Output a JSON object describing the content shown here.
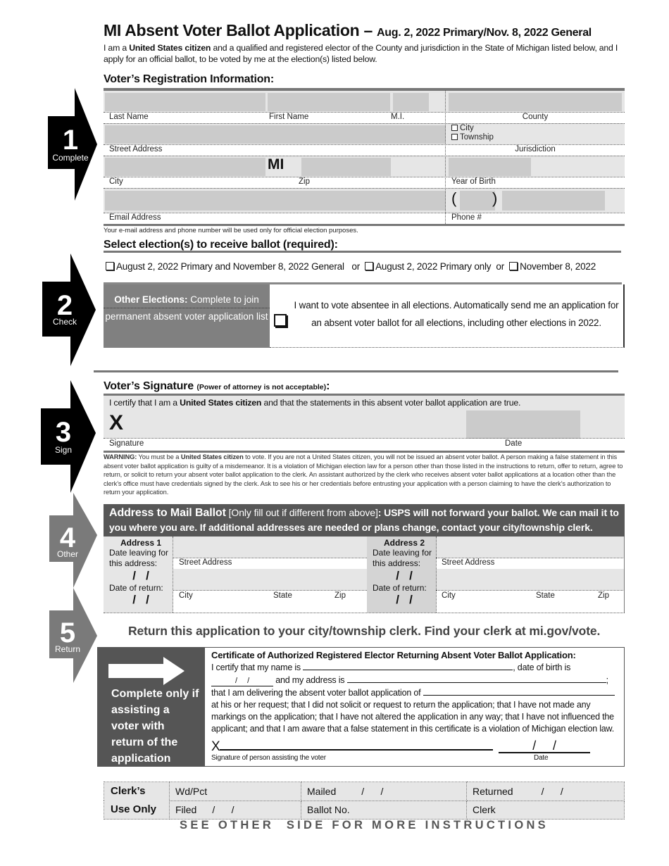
{
  "header": {
    "title": "MI Absent Voter Ballot Application –",
    "subtitle": "Aug. 2, 2022 Primary/Nov. 8, 2022 General",
    "intro_pre": "I am a ",
    "intro_bold": "United States citizen",
    "intro_post": " and a qualified and registered elector of the County and jurisdiction in the State of Michigan listed below, and I apply for an official ballot, to be voted by me at the election(s) listed below."
  },
  "steps": [
    {
      "number": "1",
      "word": "Complete"
    },
    {
      "number": "2",
      "word": "Check"
    },
    {
      "number": "3",
      "word": "Sign"
    },
    {
      "number": "4",
      "word": "Other"
    },
    {
      "number": "5",
      "word": "Return"
    }
  ],
  "registration": {
    "heading": "Voter’s Registration Information:",
    "last_name": "Last Name",
    "first_name": "First Name",
    "mi": "M.I.",
    "county": "County",
    "street": "Street Address",
    "city_option": "City",
    "township_option": "Township",
    "jurisdiction": "Jurisdiction",
    "state_value": "MI",
    "city": "City",
    "zip": "Zip",
    "year_of_birth": "Year of Birth",
    "email": "Email Address",
    "phone": "Phone #",
    "phone_open": "(",
    "phone_close": ")",
    "privacy_note": "Your e-mail address and phone number will be used only for official election purposes."
  },
  "elections": {
    "heading": "Select election(s) to receive ballot (required):",
    "option1": "August 2, 2022 Primary and November 8, 2022 General",
    "or1": "or",
    "option2": "August 2, 2022 Primary only",
    "or2": "or",
    "option3": "November 8, 2022",
    "other_title": "Other Elections:",
    "other_line1": "Complete to join",
    "other_line2": "permanent absent voter application list",
    "permanent_line1": "I want to vote absentee in all elections. Automatically send me an application for",
    "permanent_line2": "an absent voter ballot for all elections, including other elections in 2022."
  },
  "signature": {
    "heading": "Voter’s Signature",
    "heading_note": "(Power of attorney is not acceptable)",
    "colon": ":",
    "certify_pre": "I certify that I am a ",
    "certify_bold": "United States citizen",
    "certify_post": " and that the statements in this absent voter ballot application are true.",
    "x_mark": "X",
    "signature_label": "Signature",
    "date_label": "Date",
    "warning_label": "WARNING:",
    "warning_pre": " You must be a ",
    "warning_bold": "United States citizen",
    "warning_post": " to vote.  If you are not a United States citizen, you will not be issued an absent voter ballot.  A person making a false statement in this absent voter ballot application is guilty of a misdemeanor.  It is a violation of Michigan election law for a person other than those listed in the instructions to return, offer to return, agree to return, or solicit to return your absent voter ballot application to the clerk.  An assistant authorized by the clerk who receives absent voter ballot applications at a location other than the clerk’s office must have credentials signed by the clerk.  Ask to see his or her credentials before entrusting your application with a person claiming to have the clerk’s authorization to return your application."
  },
  "mail_address": {
    "heading": "Address to Mail Ballot",
    "heading_note": " [Only fill out if different from above]",
    "heading_post": ":  USPS will not forward your ballot. We can mail it to you where you are. If additional addresses are needed or plans change, contact your city/township clerk.",
    "addresses": [
      {
        "title": "Address 1",
        "leaving_label": "Date leaving for this address:",
        "return_label": "Date of return:",
        "date_slashes": "/   /",
        "street": "Street Address",
        "city": "City",
        "state": "State",
        "zip": "Zip"
      },
      {
        "title": "Address 2",
        "leaving_label": "Date leaving for this address:",
        "return_label": "Date of return:",
        "date_slashes": "/   /",
        "street": "Street Address",
        "city": "City",
        "state": "State",
        "zip": "Zip"
      }
    ]
  },
  "return": {
    "heading": "Return this application to your city/township clerk. Find your clerk at mi.gov/vote.",
    "assist_text": "Complete only if assisting a voter with return of the application",
    "cert_title": "Certificate of Authorized Registered Elector Returning Absent Voter Ballot Application:",
    "cert_name_pre": "I certify that my name is",
    "cert_dob": ", date of birth is",
    "cert_dob_slashes": "/     /",
    "cert_address": "and my address is",
    "cert_semicolon": ";",
    "cert_delivering": "that I am delivering the absent voter ballot application of",
    "cert_body": "at his or her request; that I did not solicit or request to return the application; that I have not made any markings on the application; that I have not altered the application in any way; that I have not influenced the applicant; and that I am aware that a false statement in this certificate is a violation of Michigan election law.",
    "cert_x": "X",
    "cert_sig_label": "Signature of person assisting the voter",
    "cert_date_label": "Date",
    "cert_date_slashes": "/     /"
  },
  "clerk": {
    "title_line1": "Clerk’s",
    "title_line2": "Use Only",
    "wdpct": "Wd/Pct",
    "mailed": "Mailed",
    "returned": "Returned",
    "filed": "Filed",
    "ballot_no": "Ballot No.",
    "clerk": "Clerk",
    "slashes": "/      /"
  },
  "footer": {
    "note": "SEE OTHER  SIDE FOR MORE INSTRUCTIONS"
  }
}
